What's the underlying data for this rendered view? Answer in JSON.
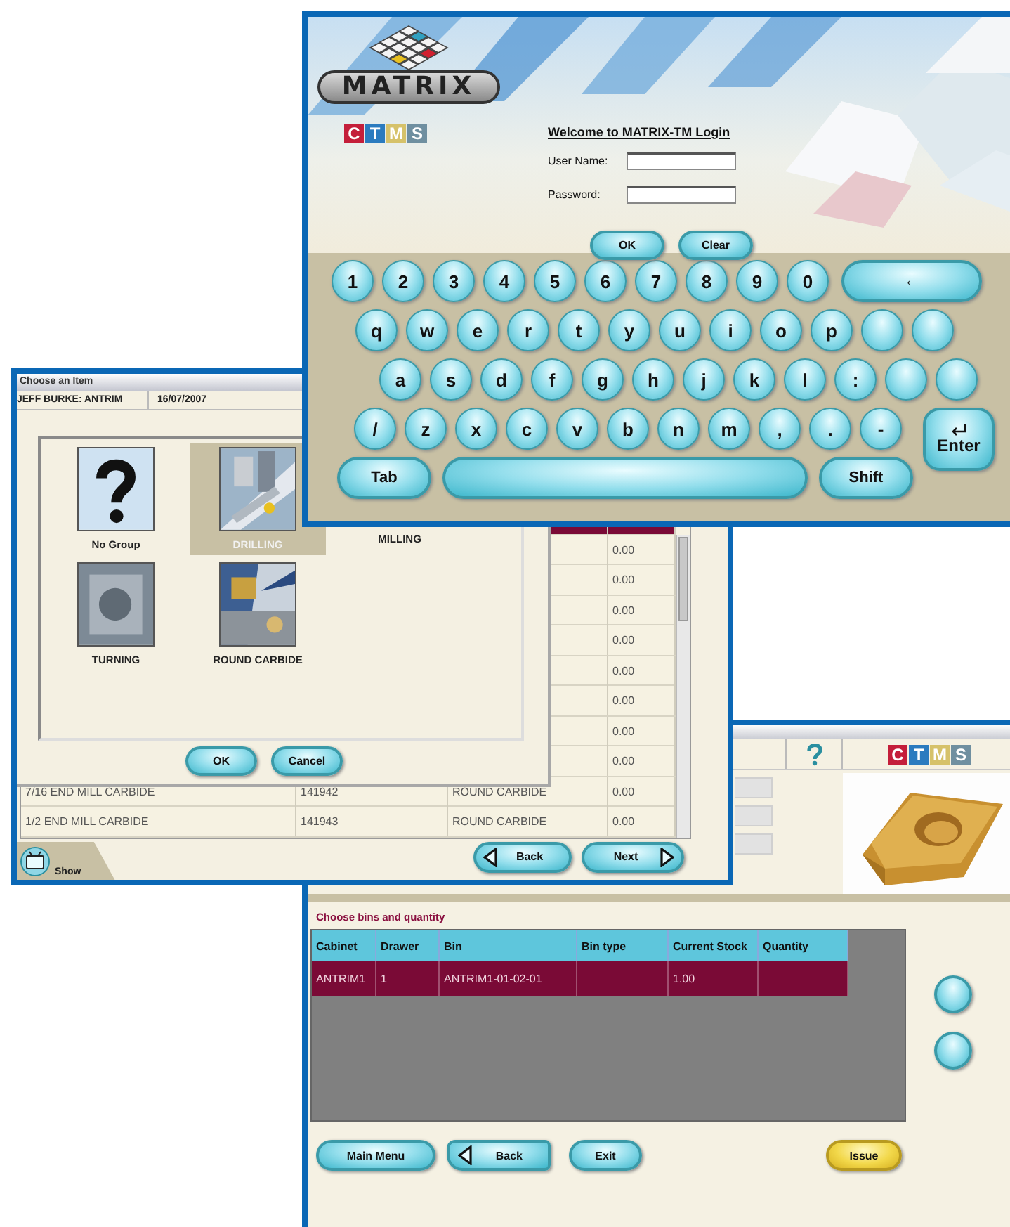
{
  "login_window": {
    "logo": "MATRIX",
    "badge": [
      {
        "letter": "C",
        "color": "#c41e3a"
      },
      {
        "letter": "T",
        "color": "#2b7bbf"
      },
      {
        "letter": "M",
        "color": "#d6c26a"
      },
      {
        "letter": "S",
        "color": "#6f8fa0"
      }
    ],
    "heading": "Welcome to MATRIX-TM Login",
    "fields": [
      {
        "label": "User Name:"
      },
      {
        "label": "Password:"
      }
    ],
    "buttons": [
      "OK",
      "Clear"
    ],
    "keyboard": {
      "rows": [
        [
          {
            "label": "1"
          },
          {
            "label": "2"
          },
          {
            "label": "3"
          },
          {
            "label": "4"
          },
          {
            "label": "5"
          },
          {
            "label": "6"
          },
          {
            "label": "7"
          },
          {
            "label": "8"
          },
          {
            "label": "9"
          },
          {
            "label": "0"
          },
          {
            "kind": "wide",
            "label": "←"
          }
        ],
        [
          {
            "label": "q"
          },
          {
            "label": "w"
          },
          {
            "label": "e"
          },
          {
            "label": "r"
          },
          {
            "label": "t"
          },
          {
            "label": "y"
          },
          {
            "label": "u"
          },
          {
            "label": "i"
          },
          {
            "label": "o"
          },
          {
            "label": "p"
          },
          {
            "kind": "blank"
          },
          {
            "kind": "blank"
          }
        ],
        [
          {
            "label": "a"
          },
          {
            "label": "s"
          },
          {
            "label": "d"
          },
          {
            "label": "f"
          },
          {
            "label": "g"
          },
          {
            "label": "h"
          },
          {
            "label": "j"
          },
          {
            "label": "k"
          },
          {
            "label": "l"
          },
          {
            "label": ":"
          },
          {
            "kind": "blank"
          },
          {
            "kind": "blank"
          }
        ],
        [
          {
            "label": "/"
          },
          {
            "label": "z"
          },
          {
            "label": "x"
          },
          {
            "label": "c"
          },
          {
            "label": "v"
          },
          {
            "label": "b"
          },
          {
            "label": "n"
          },
          {
            "label": "m"
          },
          {
            "label": ","
          },
          {
            "label": "."
          },
          {
            "label": "-"
          }
        ],
        [
          {
            "kind": "wide",
            "label": "Tab"
          },
          {
            "kind": "space"
          },
          {
            "kind": "wide",
            "label": "Shift"
          }
        ]
      ],
      "enter": "Enter"
    }
  },
  "items_window": {
    "title": "Choose an Item",
    "user": "JEFF BURKE: ANTRIM",
    "date": "16/07/2007",
    "groups": [
      {
        "label": "No Group",
        "kind": "question",
        "selected": false
      },
      {
        "label": "DRILLING",
        "kind": "picture",
        "selected": true
      },
      {
        "label": "MILLING",
        "kind": "text",
        "selected": false
      },
      {
        "label": "TURNING",
        "kind": "picture",
        "selected": false
      },
      {
        "label": "ROUND CARBIDE",
        "kind": "picture",
        "selected": false
      }
    ],
    "dialog_buttons": [
      "OK",
      "Cancel"
    ],
    "rows": [
      {
        "selected": true
      },
      {
        "stock": "0.00",
        "selected": false
      },
      {
        "stock": "0.00",
        "selected": false
      },
      {
        "stock": "0.00",
        "selected": false
      },
      {
        "stock": "0.00",
        "selected": false
      },
      {
        "stock": "0.00",
        "selected": false
      },
      {
        "stock": "0.00",
        "selected": false
      },
      {
        "stock": "0.00",
        "selected": false
      },
      {
        "stock": "0.00",
        "selected": false
      },
      {
        "name": "7/16 END MILL CARBIDE",
        "code": "141942",
        "group": "ROUND CARBIDE",
        "stock": "0.00",
        "selected": false
      },
      {
        "name": "1/2 END MILL CARBIDE",
        "code": "141943",
        "group": "ROUND CARBIDE",
        "stock": "0.00",
        "selected": false
      }
    ],
    "nav_buttons": [
      {
        "label": "Back",
        "kind": "back"
      },
      {
        "label": "Next",
        "kind": "next"
      }
    ],
    "tab": "Show"
  },
  "bins_window": {
    "badge": [
      {
        "letter": "C",
        "color": "#c41e3a"
      },
      {
        "letter": "T",
        "color": "#2b7bbf"
      },
      {
        "letter": "M",
        "color": "#d6c26a"
      },
      {
        "letter": "S",
        "color": "#6f8fa0"
      }
    ],
    "section_title": "Choose bins and quantity",
    "columns": [
      "Cabinet",
      "Drawer",
      "Bin",
      "Bin type",
      "Current Stock",
      "Quantity"
    ],
    "rows": [
      {
        "cabinet": "ANTRIM1",
        "drawer": "1",
        "bin": "ANTRIM1-01-02-01",
        "current_stock": "1.00",
        "selected": true
      }
    ],
    "buttons": [
      {
        "label": "Main Menu",
        "kind": "plain"
      },
      {
        "label": "Back",
        "kind": "back"
      },
      {
        "label": "Exit",
        "kind": "plain"
      },
      {
        "label": "Issue",
        "kind": "primary"
      }
    ]
  }
}
